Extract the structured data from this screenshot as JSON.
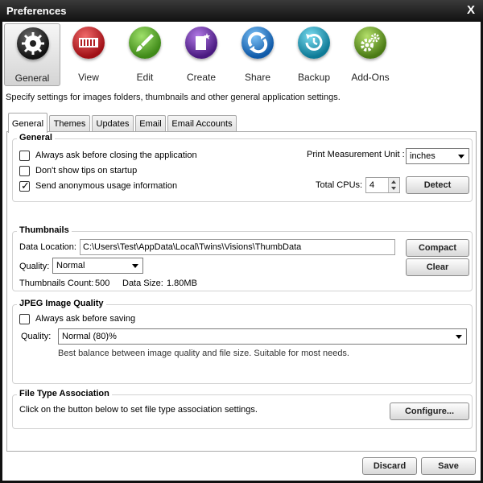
{
  "window": {
    "title": "Preferences",
    "close_glyph": "X"
  },
  "toolbar": {
    "items": [
      {
        "label": "General",
        "icon": "gear-icon",
        "color": "#2a2a2a"
      },
      {
        "label": "View",
        "icon": "filmstrip-icon",
        "color": "#c0262a"
      },
      {
        "label": "Edit",
        "icon": "brush-icon",
        "color": "#5aa52a"
      },
      {
        "label": "Create",
        "icon": "new-document-icon",
        "color": "#6a2f9e"
      },
      {
        "label": "Share",
        "icon": "share-arrows-icon",
        "color": "#2277c8"
      },
      {
        "label": "Backup",
        "icon": "backup-clock-icon",
        "color": "#1a9ab8"
      },
      {
        "label": "Add-Ons",
        "icon": "add-ons-gears-icon",
        "color": "#6a9a2a"
      }
    ],
    "selected": "General"
  },
  "description": "Specify settings for images folders, thumbnails and other general application settings.",
  "tabs": [
    "General",
    "Themes",
    "Updates",
    "Email",
    "Email Accounts"
  ],
  "general": {
    "title": "General",
    "always_ask_closing": {
      "label": "Always ask before closing the application",
      "checked": false
    },
    "dont_show_tips": {
      "label": "Don't show tips on startup",
      "checked": false
    },
    "send_usage": {
      "label": "Send anonymous usage information",
      "checked": true,
      "mark": "✓"
    },
    "measurement_label": "Print Measurement Unit :",
    "measurement_value": "inches",
    "cpus_label": "Total CPUs:",
    "cpus_value": "4",
    "detect_label": "Detect"
  },
  "thumbnails": {
    "title": "Thumbnails",
    "data_location_label": "Data Location:",
    "data_location_value": "C:\\Users\\Test\\AppData\\Local\\Twins\\Visions\\ThumbData",
    "quality_label": "Quality:",
    "quality_value": "Normal",
    "count_label": "Thumbnails Count:",
    "count_value": "500",
    "size_label": "Data Size:",
    "size_value": "1.80MB",
    "compact_label": "Compact",
    "clear_label": "Clear"
  },
  "jpeg": {
    "title": "JPEG Image Quality",
    "always_ask_saving": {
      "label": "Always ask before saving",
      "checked": false
    },
    "quality_label": "Quality:",
    "quality_value": "Normal (80)%",
    "hint": "Best balance between image quality and file size. Suitable for most needs."
  },
  "file_assoc": {
    "title": "File Type Association",
    "text": "Click on the button below to set file type association settings.",
    "configure_label": "Configure..."
  },
  "footer": {
    "discard_label": "Discard",
    "save_label": "Save"
  }
}
